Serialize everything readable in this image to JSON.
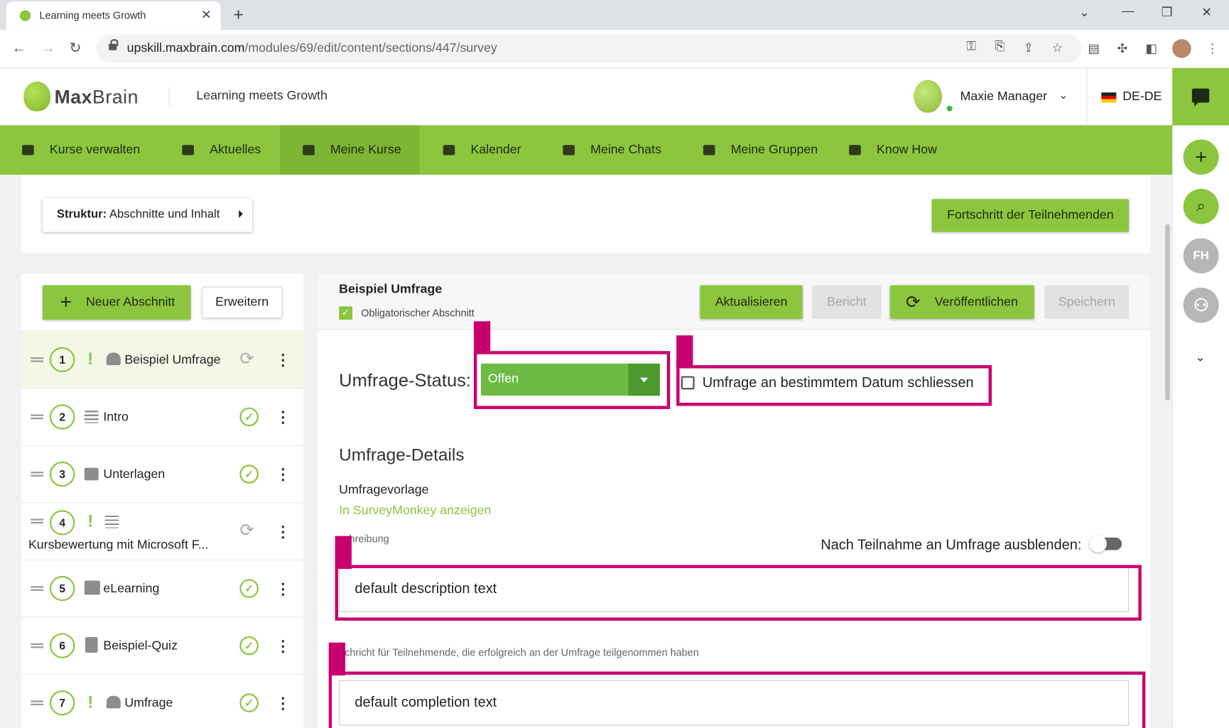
{
  "browser": {
    "tab_title": "Learning meets Growth",
    "url_host": "upskill.maxbrain.com",
    "url_path": "/modules/69/edit/content/sections/447/survey"
  },
  "header": {
    "brand_bold": "Max",
    "brand_light": "Brain",
    "title": "Learning meets Growth",
    "user_name": "Maxie Manager",
    "language": "DE-DE"
  },
  "nav": {
    "items": [
      {
        "label": "Kurse verwalten"
      },
      {
        "label": "Aktuelles"
      },
      {
        "label": "Meine Kurse"
      },
      {
        "label": "Kalender"
      },
      {
        "label": "Meine Chats"
      },
      {
        "label": "Meine Gruppen"
      },
      {
        "label": "Know How"
      }
    ],
    "active": "Meine Kurse"
  },
  "rail": {
    "initials": "FH"
  },
  "structure": {
    "label_bold": "Struktur:",
    "label_value": "Abschnitte und Inhalt",
    "progress_button": "Fortschritt der Teilnehmenden"
  },
  "sections_panel": {
    "new_section": "Neuer Abschnitt",
    "expand": "Erweitern",
    "items": [
      {
        "num": "1",
        "title": "Beispiel Umfrage",
        "mandatory": true,
        "type": "survey-icon",
        "status": "sync"
      },
      {
        "num": "2",
        "title": "Intro",
        "mandatory": false,
        "type": "text-icon",
        "status": "ok"
      },
      {
        "num": "3",
        "title": "Unterlagen",
        "mandatory": false,
        "type": "folder-icon",
        "status": "ok"
      },
      {
        "num": "4",
        "title": "Kursbewertung mit Microsoft F...",
        "mandatory": true,
        "type": "text-icon",
        "status": "sync"
      },
      {
        "num": "5",
        "title": "eLearning",
        "mandatory": false,
        "type": "elearning-icon",
        "status": "ok"
      },
      {
        "num": "6",
        "title": "Beispiel-Quiz",
        "mandatory": false,
        "type": "quiz-icon",
        "status": "ok"
      },
      {
        "num": "7",
        "title": "Umfrage",
        "mandatory": true,
        "type": "survey-icon",
        "status": "ok"
      }
    ]
  },
  "editor": {
    "title": "Beispiel Umfrage",
    "mandatory_label": "Obligatorischer Abschnitt",
    "buttons": {
      "update": "Aktualisieren",
      "report": "Bericht",
      "publish": "Veröffentlichen",
      "save": "Speichern"
    },
    "survey_status_label": "Umfrage-Status:",
    "survey_status_value": "Offen",
    "close_on_date_label": "Umfrage an bestimmtem Datum schliessen",
    "details_heading": "Umfrage-Details",
    "template_label": "Umfragevorlage",
    "template_link": "In SurveyMonkey anzeigen",
    "description_label": "schreibung",
    "hide_after_label": "Nach Teilnahme an Umfrage ausblenden:",
    "description_value": "default description text",
    "completion_label": "achricht für Teilnehmende, die erfolgreich an der Umfrage teilgenommen haben",
    "completion_value": "default completion text"
  },
  "colors": {
    "brand_green": "#8cc63f",
    "status_green": "#6dbb45",
    "annotation": "#c8006f"
  }
}
